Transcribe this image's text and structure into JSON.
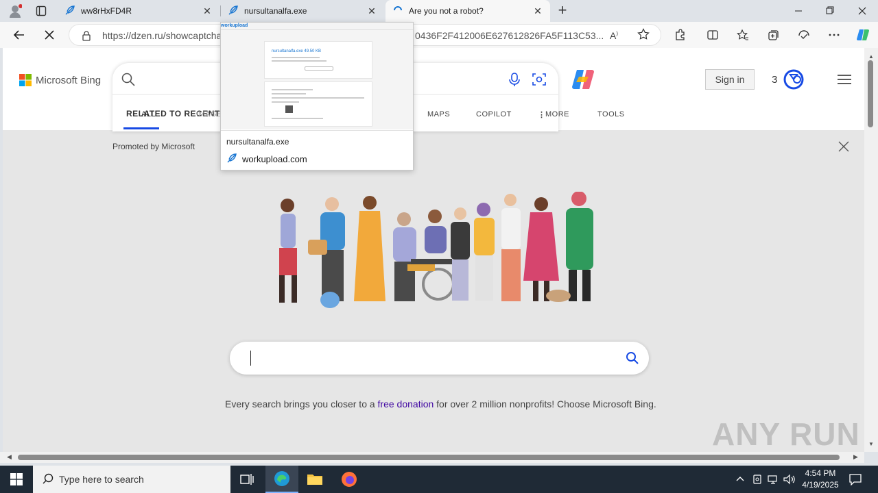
{
  "tabs": [
    {
      "title": "ww8rHxFD4R",
      "active": false
    },
    {
      "title": "nursultanalfa.exe",
      "active": false
    },
    {
      "title": "Are you not a robot?",
      "active": true
    }
  ],
  "address": {
    "url_left": "https://dzen.ru/showcaptcha",
    "url_right": "0436F2F412006E627612826FA5F113C53..."
  },
  "bing": {
    "logo_text": "Microsoft Bing",
    "scopes": [
      "ALL",
      "IMAGES",
      "MAPS",
      "COPILOT",
      "MORE",
      "TOOLS"
    ],
    "related_label": "RELATED TO RECENT SE",
    "sign_in": "Sign in",
    "rewards_count": "3",
    "promoted": "Promoted by Microsoft",
    "promo_before": "Every search brings you closer to a ",
    "promo_link": "free donation",
    "promo_after": " for over 2 million nonprofits! Choose Microsoft Bing."
  },
  "popup": {
    "thumb_site": "workupload",
    "thumb_title": "nursultanalfa.exe 49.50 KB",
    "title": "nursultanalfa.exe",
    "site": "workupload.com"
  },
  "taskbar": {
    "search_placeholder": "Type here to search",
    "time": "4:54 PM",
    "date": "4/19/2025"
  },
  "watermark": "ANY RUN",
  "colors": {
    "accent": "#174ae4",
    "promo_link": "#4007a2",
    "taskbar": "#1f2a36"
  }
}
